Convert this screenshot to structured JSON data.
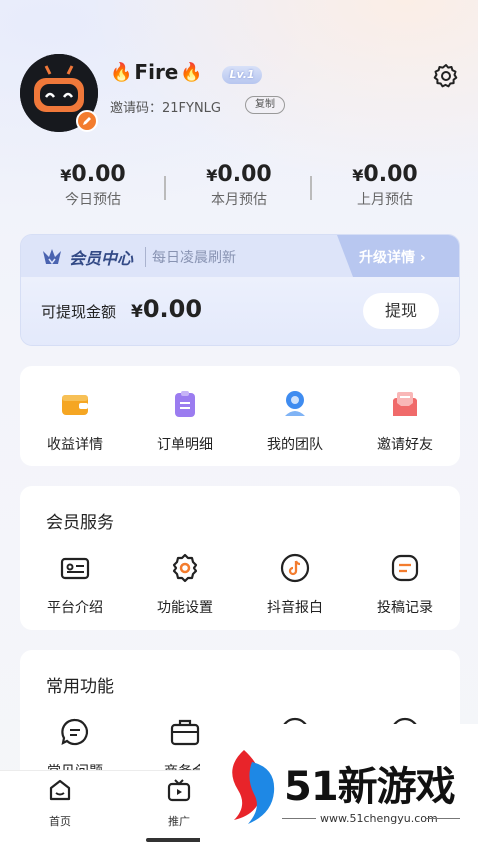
{
  "profile": {
    "flame_left": "🔥",
    "name": "Fire",
    "flame_right": "🔥",
    "level": "Lv.1",
    "invite_label": "邀请码：21FYNLG",
    "copy_label": "复制"
  },
  "stats": [
    {
      "value": "0.00",
      "currency": "¥",
      "label": "今日预估"
    },
    {
      "value": "0.00",
      "currency": "¥",
      "label": "本月预估"
    },
    {
      "value": "0.00",
      "currency": "¥",
      "label": "上月预估"
    }
  ],
  "member": {
    "title": "会员中心",
    "subtitle": "每日凌晨刷新",
    "upgrade": "升级详情 ›",
    "withdraw_label": "可提现金额",
    "currency": "¥",
    "withdraw_amount": "0.00",
    "withdraw_button": "提现"
  },
  "quick": [
    {
      "label": "收益详情",
      "icon": "wallet-icon",
      "color": "#f5a623"
    },
    {
      "label": "订单明细",
      "icon": "order-icon",
      "color": "#9b7cf0"
    },
    {
      "label": "我的团队",
      "icon": "team-icon",
      "color": "#3f8cf0"
    },
    {
      "label": "邀请好友",
      "icon": "invite-icon",
      "color": "#f06a6a"
    }
  ],
  "service": {
    "title": "会员服务",
    "items": [
      {
        "label": "平台介绍",
        "icon": "id-card-icon"
      },
      {
        "label": "功能设置",
        "icon": "gear-flower-icon"
      },
      {
        "label": "抖音报白",
        "icon": "tiktok-icon"
      },
      {
        "label": "投稿记录",
        "icon": "note-icon"
      }
    ]
  },
  "common": {
    "title": "常用功能",
    "items": [
      {
        "label": "常见问题",
        "icon": "chat-icon"
      },
      {
        "label": "商务合",
        "icon": "briefcase-icon"
      },
      {
        "label": "",
        "icon": "circle-icon"
      },
      {
        "label": "",
        "icon": "info-icon"
      }
    ]
  },
  "tabs": [
    {
      "label": "首页",
      "icon": "home-icon"
    },
    {
      "label": "推广",
      "icon": "tv-icon"
    }
  ],
  "watermark": {
    "text": "51新游戏",
    "url": "www.51chengyu.com"
  }
}
